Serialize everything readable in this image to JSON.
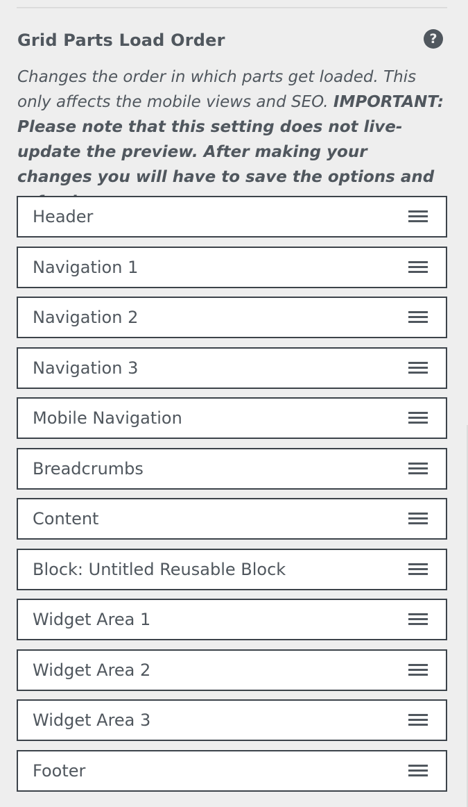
{
  "section": {
    "title": "Grid Parts Load Order",
    "help_icon": "?",
    "description_normal": "Changes the order in which parts get loaded. This only affects the mobile views and SEO.",
    "description_important": "IMPORTANT: Please note that this setting does not live-update the preview. After making your changes you will have to save the options and refresh your page."
  },
  "items": [
    {
      "label": "Header",
      "icon": "drag-handle-icon"
    },
    {
      "label": "Navigation 1",
      "icon": "drag-handle-icon"
    },
    {
      "label": "Navigation 2",
      "icon": "drag-handle-icon"
    },
    {
      "label": "Navigation 3",
      "icon": "drag-handle-icon"
    },
    {
      "label": "Mobile Navigation",
      "icon": "drag-handle-icon"
    },
    {
      "label": "Breadcrumbs",
      "icon": "drag-handle-icon"
    },
    {
      "label": "Content",
      "icon": "drag-handle-icon"
    },
    {
      "label": "Block: Untitled Reusable Block",
      "icon": "drag-handle-icon"
    },
    {
      "label": "Widget Area 1",
      "icon": "drag-handle-icon"
    },
    {
      "label": "Widget Area 2",
      "icon": "drag-handle-icon"
    },
    {
      "label": "Widget Area 3",
      "icon": "drag-handle-icon"
    },
    {
      "label": "Footer",
      "icon": "drag-handle-icon"
    }
  ],
  "colors": {
    "background": "#eeeeee",
    "text": "#50575e",
    "item_border": "#3c434a",
    "item_background": "#ffffff"
  }
}
